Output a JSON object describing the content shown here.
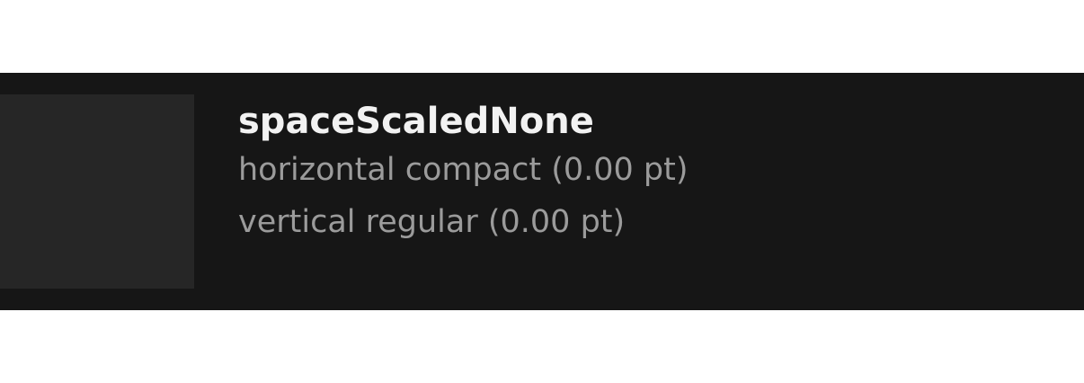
{
  "token": {
    "name": "spaceScaledNone",
    "horizontal": "horizontal compact (0.00 pt)",
    "vertical": "vertical regular (0.00 pt)",
    "colors": {
      "card_background": "#161616",
      "swatch_background": "#262626",
      "title_text": "#f2f2f2",
      "detail_text": "#9b9b9b"
    }
  }
}
